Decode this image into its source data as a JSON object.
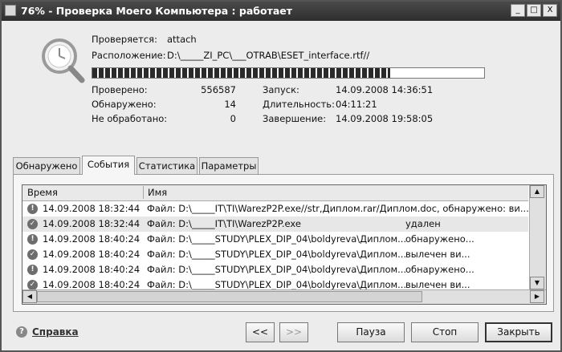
{
  "window": {
    "title": "76% - Проверка Моего Компьютера : работает",
    "min_label": "_",
    "max_label": "□",
    "close_label": "X"
  },
  "scan": {
    "checking_label": "Проверяется:",
    "checking_value": "attach",
    "location_label": "Расположение:",
    "location_value": "D:\\_____ZI_PC\\___OTRAB\\ESET_interface.rtf//",
    "progress": 0.76,
    "checked_label": "Проверено:",
    "checked_value": "556587",
    "found_label": "Обнаружено:",
    "found_value": "14",
    "unprocessed_label": "Не обработано:",
    "unprocessed_value": "0",
    "start_label": "Запуск:",
    "start_value": "14.09.2008 14:36:51",
    "duration_label": "Длительность:",
    "duration_value": "04:11:21",
    "end_label": "Завершение:",
    "end_value": "14.09.2008 19:58:05"
  },
  "tabs": [
    {
      "label": "Обнаружено"
    },
    {
      "label": "События"
    },
    {
      "label": "Статистика"
    },
    {
      "label": "Параметры"
    }
  ],
  "table": {
    "col_time": "Время",
    "col_name": "Имя",
    "rows": [
      {
        "icon": "!",
        "time": "14.09.2008 18:32:44",
        "name": "Файл: D:\\_____IT\\TI\\WarezP2P.exe//str,Диплом.rar/Диплом.doc, обнаружено: ви...",
        "status": ""
      },
      {
        "icon": "✓",
        "time": "14.09.2008 18:32:44",
        "name": "Файл: D:\\_____IT\\TI\\WarezP2P.exe",
        "status": "удален"
      },
      {
        "icon": "!",
        "time": "14.09.2008 18:40:24",
        "name": "Файл: D:\\_____STUDY\\PLEX_DIP_04\\boldyreva\\Диплом...",
        "status": "обнаружено..."
      },
      {
        "icon": "✓",
        "time": "14.09.2008 18:40:24",
        "name": "Файл: D:\\_____STUDY\\PLEX_DIP_04\\boldyreva\\Диплом...",
        "status": "вылечен ви..."
      },
      {
        "icon": "!",
        "time": "14.09.2008 18:40:24",
        "name": "Файл: D:\\_____STUDY\\PLEX_DIP_04\\boldyreva\\Диплом...",
        "status": "обнаружено..."
      },
      {
        "icon": "✓",
        "time": "14.09.2008 18:40:24",
        "name": "Файл: D:\\_____STUDY\\PLEX_DIP_04\\boldyreva\\Диплом...",
        "status": "вылечен ви..."
      }
    ]
  },
  "footer": {
    "help_label": "Справка",
    "back_label": "<<",
    "forward_label": ">>",
    "pause_label": "Пауза",
    "stop_label": "Стоп",
    "close_label": "Закрыть"
  }
}
